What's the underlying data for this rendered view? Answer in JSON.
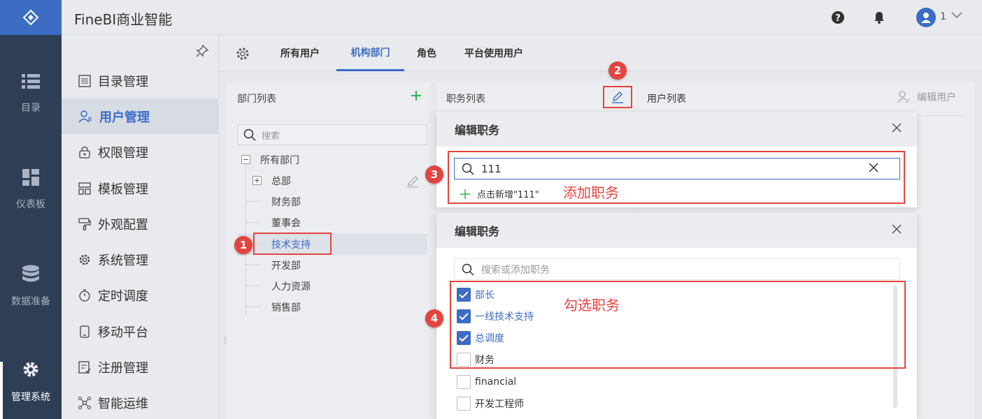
{
  "header": {
    "title": "FineBI商业智能",
    "user_name": "1"
  },
  "rail": {
    "items": [
      {
        "label": "目录",
        "icon": "list-icon"
      },
      {
        "label": "仪表板",
        "icon": "dashboard-icon"
      },
      {
        "label": "数据准备",
        "icon": "database-icon"
      },
      {
        "label": "管理系统",
        "icon": "gear-icon",
        "active": true
      }
    ]
  },
  "sidebar": {
    "items": [
      {
        "label": "目录管理",
        "icon": "catalog-icon"
      },
      {
        "label": "用户管理",
        "icon": "user-icon",
        "active": true
      },
      {
        "label": "权限管理",
        "icon": "lock-icon"
      },
      {
        "label": "模板管理",
        "icon": "template-icon"
      },
      {
        "label": "外观配置",
        "icon": "paint-roller-icon"
      },
      {
        "label": "系统管理",
        "icon": "settings-icon"
      },
      {
        "label": "定时调度",
        "icon": "timer-icon"
      },
      {
        "label": "移动平台",
        "icon": "mobile-icon"
      },
      {
        "label": "注册管理",
        "icon": "register-icon"
      },
      {
        "label": "智能运维",
        "icon": "network-icon"
      }
    ]
  },
  "tabs": [
    {
      "label": "所有用户"
    },
    {
      "label": "机构部门",
      "active": true
    },
    {
      "label": "角色"
    },
    {
      "label": "平台使用用户"
    }
  ],
  "dept_panel": {
    "title": "部门列表",
    "search_placeholder": "搜索",
    "tree": {
      "root": "所有部门",
      "children": [
        "总部",
        "财务部",
        "董事会",
        "技术支持",
        "开发部",
        "人力资源",
        "销售部"
      ],
      "selected": "技术支持"
    }
  },
  "pos_panel": {
    "title": "职务列表"
  },
  "user_panel": {
    "title": "用户列表",
    "edit_label": "编辑用户"
  },
  "dialog_add": {
    "title": "编辑职务",
    "search_value": "111",
    "suggestion": "点击新增\"111\""
  },
  "dialog_select": {
    "title": "编辑职务",
    "search_placeholder": "搜索或添加职务",
    "options": [
      {
        "label": "部长",
        "checked": true
      },
      {
        "label": "一线技术支持",
        "checked": true
      },
      {
        "label": "总调度",
        "checked": true
      },
      {
        "label": "财务",
        "checked": false
      },
      {
        "label": "financial",
        "checked": false
      },
      {
        "label": "开发工程师",
        "checked": false
      }
    ]
  },
  "annotations": {
    "badges": [
      "1",
      "2",
      "3",
      "4"
    ],
    "text_add": "添加职务",
    "text_select": "勾选职务"
  },
  "colors": {
    "accent": "#3c6cc4",
    "annotation": "#e4443f",
    "rail": "#2e3e55"
  }
}
